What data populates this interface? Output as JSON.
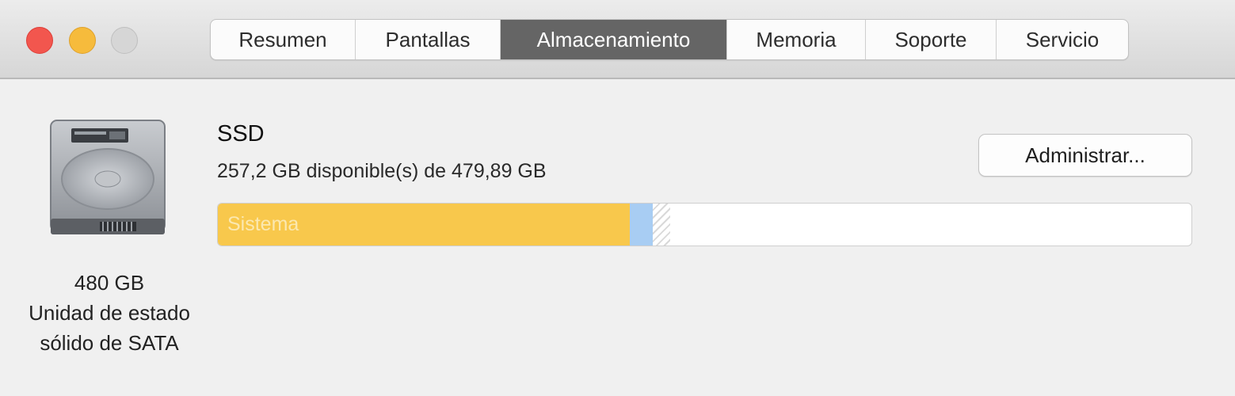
{
  "window": {
    "traffic_lights": [
      "close",
      "minimize",
      "zoom"
    ],
    "colors": {
      "close": "#f2564e",
      "minimize": "#f6bb3c",
      "zoom_inactive": "#d6d6d6"
    }
  },
  "tabs": [
    {
      "label": "Resumen",
      "active": false
    },
    {
      "label": "Pantallas",
      "active": false
    },
    {
      "label": "Almacenamiento",
      "active": true
    },
    {
      "label": "Memoria",
      "active": false
    },
    {
      "label": "Soporte",
      "active": false
    },
    {
      "label": "Servicio",
      "active": false
    }
  ],
  "disk": {
    "icon": "hard-drive-icon",
    "capacity": "480 GB",
    "type_line1": "Unidad de estado",
    "type_line2": "sólido de SATA"
  },
  "volume": {
    "name": "SSD",
    "availability": "257,2 GB disponible(s) de 479,89 GB",
    "manage_button": "Administrar..."
  },
  "storage_bar": {
    "total_gb": 479.89,
    "free_gb": 257.2,
    "segments": [
      {
        "name": "Sistema",
        "fraction": 0.423,
        "color": "#f8c84c"
      },
      {
        "name": "",
        "fraction": 0.024,
        "color": "#a8cdf3"
      },
      {
        "name": "",
        "fraction": 0.018,
        "color": "purgeable-hatch"
      }
    ]
  }
}
